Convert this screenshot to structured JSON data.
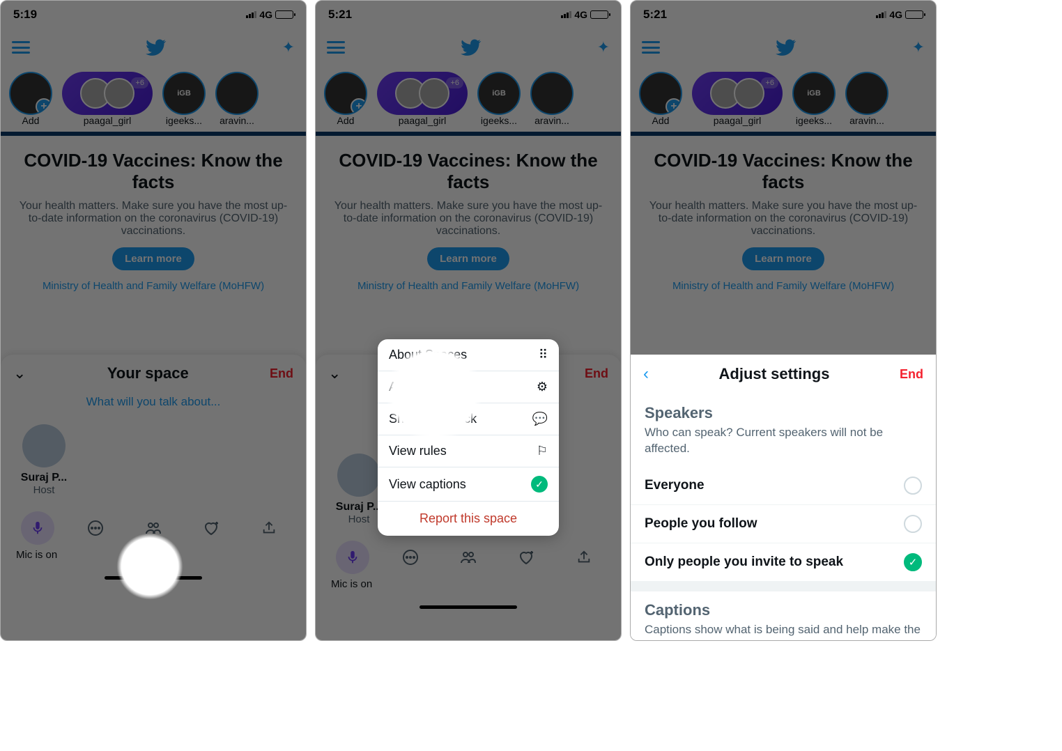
{
  "status": {
    "time1": "5:19",
    "time2": "5:21",
    "time3": "5:21",
    "net": "4G"
  },
  "fleets": {
    "add": "Add",
    "space_label": "paagal_girl",
    "space_badge": "+6",
    "item3": "igeeks...",
    "item4": "aravin...",
    "igb": "iGB"
  },
  "banner": {
    "title": "COVID-19 Vaccines: Know the facts",
    "desc": "Your health matters. Make sure you have the most up-to-date information on the coronavirus (COVID-19) vaccinations.",
    "cta": "Learn more",
    "source": "Ministry of Health and Family Welfare (MoHFW)"
  },
  "space": {
    "title": "Your space",
    "end": "End",
    "prompt": "What will you talk about...",
    "host_name": "Suraj P...",
    "host_role": "Host",
    "mic_label": "Mic is on"
  },
  "popover": {
    "about": "About Spaces",
    "adjust": "Adjust settings",
    "feedback": "Share feedback",
    "rules": "View rules",
    "captions": "View captions",
    "report": "Report this space"
  },
  "settings": {
    "title": "Adjust settings",
    "end": "End",
    "speakers_h": "Speakers",
    "speakers_d": "Who can speak? Current speakers will not be affected.",
    "opt1": "Everyone",
    "opt2": "People you follow",
    "opt3": "Only people you invite to speak",
    "captions_h": "Captions",
    "captions_d": "Captions show what is being said and help make the space more accessible. They are auto-"
  }
}
